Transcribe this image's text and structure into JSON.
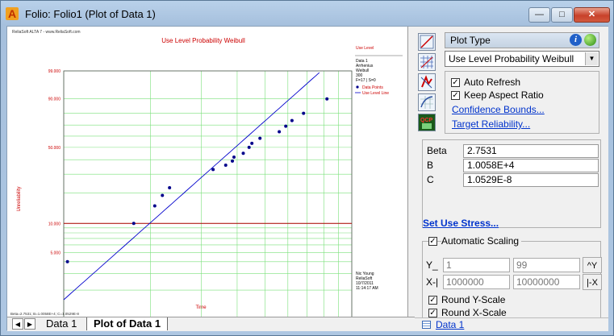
{
  "window": {
    "title": "Folio: Folio1 (Plot of Data 1)",
    "min_glyph": "—",
    "max_glyph": "□",
    "close_glyph": "✕"
  },
  "plot": {
    "header_left": "ReliaSoft ALTA 7 - www.ReliaSoft.com",
    "title": "Use Level Probability Weibull",
    "ylabel": "Unreliability",
    "xlabel": "Time",
    "footer": "Beta=2.7531; B=1.0058E+4; C=1.0529E-8",
    "legend_title": "Use Level",
    "legend_lines": [
      "Data 1",
      "Arrhenius",
      "Weibull",
      "300",
      "F=17 | S=0"
    ],
    "legend_points_label": "Data Points",
    "legend_line_label": "Use Level Line",
    "user_lines": [
      "Nic Young",
      "ReliaSoft",
      "10/7/2011",
      "11:14:17 AM"
    ],
    "colors": {
      "title": "#cc0000",
      "points": "#00008b",
      "line": "#0000cc",
      "grid": "#7ae07a",
      "ref": "#b00000"
    }
  },
  "chart_data": {
    "type": "scatter",
    "title": "Use Level Probability Weibull",
    "xlabel": "Time",
    "ylabel": "Unreliability",
    "x_scale": "log",
    "y_scale": "weibull",
    "xlim": [
      1000000,
      10000000
    ],
    "ylim": [
      1,
      99
    ],
    "x_ticks": [
      "1000000.000",
      "1.000E+7"
    ],
    "y_ticks": [
      "99.000",
      "90.000",
      "50.000",
      "10.000",
      "5.000",
      "1.000"
    ],
    "y_tick_values": [
      99,
      90,
      50,
      10,
      5,
      1
    ],
    "reference_line_y": 10,
    "series": [
      {
        "name": "Data Points",
        "x": [
          1030000,
          1750000,
          2070000,
          2200000,
          2330000,
          3300000,
          3650000,
          3850000,
          3900000,
          4200000,
          4400000,
          4500000,
          4800000,
          5600000,
          5900000,
          6200000,
          6800000,
          8200000
        ],
        "y": [
          4.0,
          10.0,
          15.0,
          19.0,
          22.5,
          33.0,
          36.0,
          39.0,
          42.0,
          45.0,
          50.0,
          53.5,
          58.0,
          64.0,
          69.0,
          74.0,
          80.0,
          90.0
        ]
      },
      {
        "name": "Use Level Line",
        "fit": {
          "beta": 2.7531,
          "eta": 4500000
        }
      }
    ]
  },
  "right": {
    "plot_type_label": "Plot Type",
    "plot_type_value": "Use Level Probability Weibull",
    "dropdown_glyph": "▼",
    "auto_refresh": "Auto Refresh",
    "keep_aspect": "Keep Aspect Ratio",
    "checkmark": "✓",
    "confidence_bounds": "Confidence Bounds...",
    "target_reliability": "Target Reliability...",
    "params": [
      {
        "name": "Beta",
        "value": "2.7531"
      },
      {
        "name": "B",
        "value": "1.0058E+4"
      },
      {
        "name": "C",
        "value": "1.0529E-8"
      }
    ],
    "set_use_stress": "Set Use Stress...",
    "automatic_scaling": "Automatic Scaling",
    "y_label": "Y_",
    "x_label": "X-|",
    "y_min": "1",
    "y_max": "99",
    "x_min": "1000000",
    "x_max": "10000000",
    "y_btn": "^Y",
    "x_btn": "|-X",
    "round_y": "Round Y-Scale",
    "round_x": "Round X-Scale",
    "datasheet_link": "Data 1"
  },
  "tabs": {
    "prev_glyph": "◀",
    "next_glyph": "▶",
    "items": [
      "Data 1",
      "Plot of Data 1"
    ]
  }
}
